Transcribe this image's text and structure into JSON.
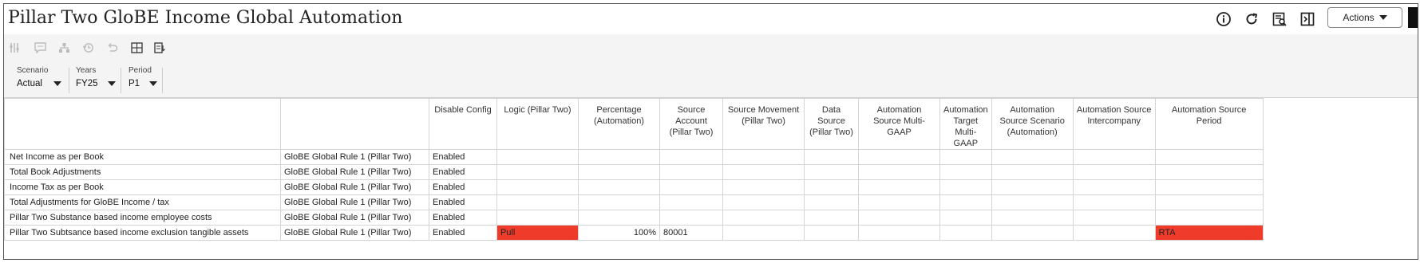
{
  "app": {
    "title": "Pillar Two GloBE Income Global Automation",
    "actions_label": "Actions"
  },
  "header_icons": [
    "info-icon",
    "refresh-icon",
    "inspect-icon",
    "panel-icon"
  ],
  "toolbar_icons": [
    "grid-adjust-icon",
    "comment-icon",
    "hierarchy-icon",
    "history-icon",
    "undo-icon",
    "table-icon",
    "export-icon"
  ],
  "pov": [
    {
      "label": "Scenario",
      "value": "Actual"
    },
    {
      "label": "Years",
      "value": "FY25"
    },
    {
      "label": "Period",
      "value": "P1"
    }
  ],
  "grid": {
    "columns": [
      "Disable Config",
      "Logic (Pillar Two)",
      "Percentage (Automation)",
      "Source Account (Pillar Two)",
      "Source Movement (Pillar Two)",
      "Data Source (Pillar Two)",
      "Automation Source Multi-GAAP",
      "Automation Target Multi-GAAP",
      "Automation Source Scenario (Automation)",
      "Automation Source Intercompany",
      "Automation Source Period"
    ],
    "rows": [
      {
        "account": "Net Income as per Book",
        "rule": "GloBE Global Rule 1 (Pillar Two)",
        "cells": [
          "Enabled",
          "",
          "",
          "",
          "",
          "",
          "",
          "",
          "",
          "",
          ""
        ]
      },
      {
        "account": "Total Book Adjustments",
        "rule": "GloBE Global Rule 1 (Pillar Two)",
        "cells": [
          "Enabled",
          "",
          "",
          "",
          "",
          "",
          "",
          "",
          "",
          "",
          ""
        ]
      },
      {
        "account": "Income Tax as per Book",
        "rule": "GloBE Global Rule 1 (Pillar Two)",
        "cells": [
          "Enabled",
          "",
          "",
          "",
          "",
          "",
          "",
          "",
          "",
          "",
          ""
        ]
      },
      {
        "account": "Total Adjustments for GloBE Income / tax",
        "rule": "GloBE Global Rule 1 (Pillar Two)",
        "cells": [
          "Enabled",
          "",
          "",
          "",
          "",
          "",
          "",
          "",
          "",
          "",
          ""
        ]
      },
      {
        "account": "Pillar Two Substance based income employee costs",
        "rule": "GloBE Global Rule 1 (Pillar Two)",
        "cells": [
          "Enabled",
          "",
          "",
          "",
          "",
          "",
          "",
          "",
          "",
          "",
          ""
        ]
      },
      {
        "account": "Pillar Two Subtsance based income exclusion tangible assets",
        "rule": "GloBE Global Rule 1 (Pillar Two)",
        "cells": [
          "Enabled",
          "Pull",
          "100%",
          "80001",
          "",
          "",
          "",
          "",
          "",
          "",
          "RTA"
        ]
      }
    ],
    "highlight_color": "#ee3b2a"
  }
}
